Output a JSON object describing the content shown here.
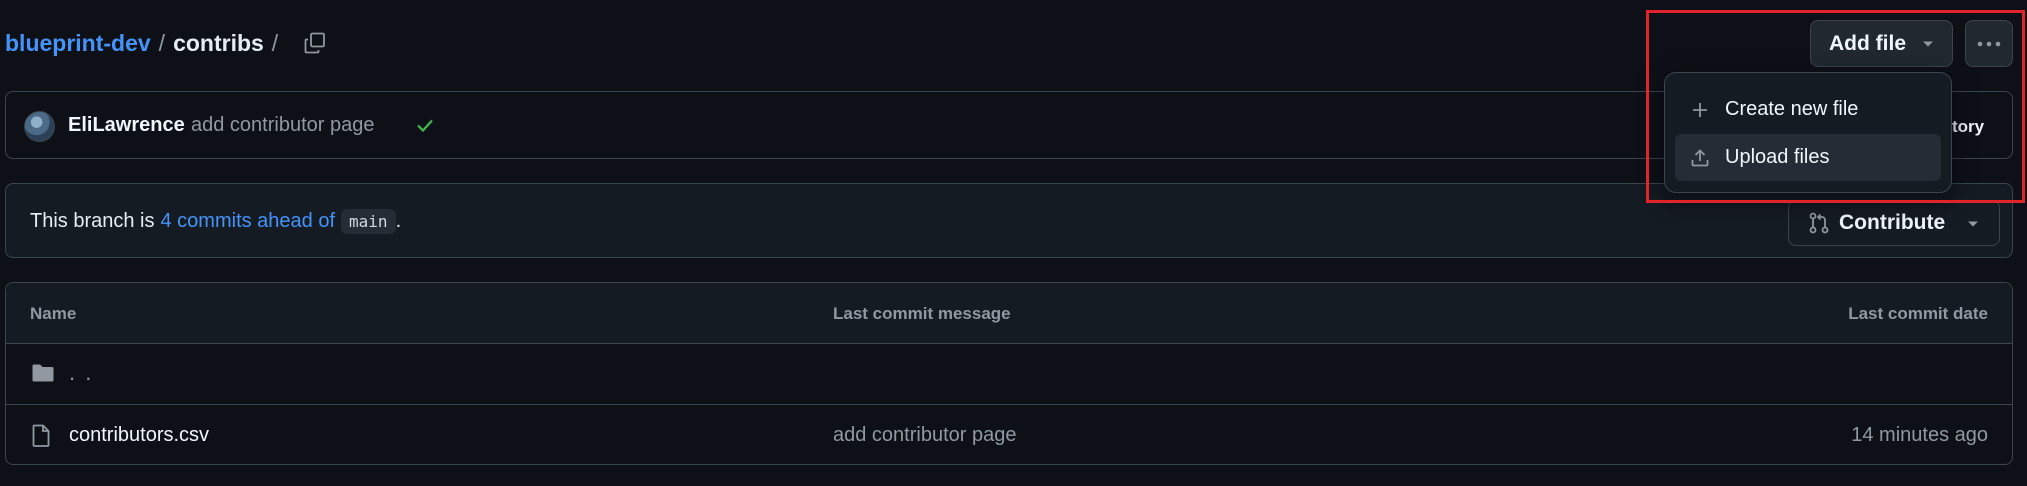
{
  "breadcrumb": {
    "owner": "blueprint-dev",
    "separator": "/",
    "folder": "contribs",
    "trailing_separator": "/"
  },
  "toolbar": {
    "add_file_label": "Add file",
    "more_options_icon": "kebab-horizontal-icon"
  },
  "dropdown": {
    "items": [
      {
        "label": "Create new file",
        "icon": "plus-icon"
      },
      {
        "label": "Upload files",
        "icon": "upload-icon"
      }
    ]
  },
  "commit_bar": {
    "author": "EliLawrence",
    "message": "add contributor page",
    "status": "check-icon",
    "history_label_partial": "tory"
  },
  "branch_banner": {
    "prefix": "This branch is",
    "ahead_link": "4 commits ahead of",
    "base_branch": "main",
    "suffix": ".",
    "contribute_label": "Contribute"
  },
  "table": {
    "columns": [
      "Name",
      "Last commit message",
      "Last commit date"
    ],
    "parent_row": {
      "name": ". ."
    },
    "rows": [
      {
        "name": "contributors.csv",
        "message": "add contributor page",
        "date": "14 minutes ago"
      }
    ]
  },
  "colors": {
    "background": "#0d1117",
    "link": "#4493f8",
    "success": "#3fb950",
    "annotation": "#e0242a"
  }
}
